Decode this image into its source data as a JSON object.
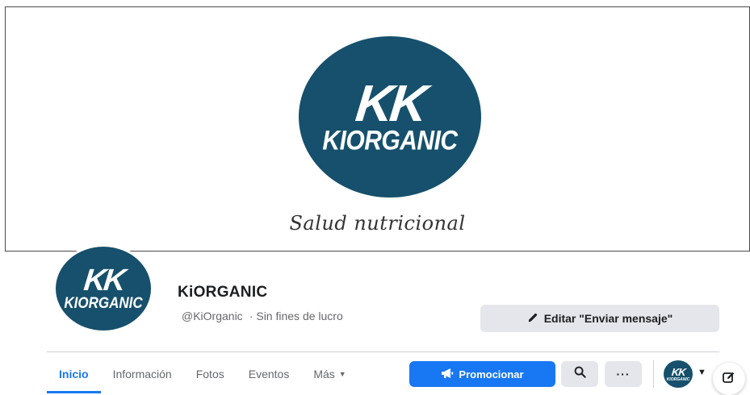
{
  "cover": {
    "logo_mark": "KK",
    "logo_word": "KIORGANIC",
    "tagline": "Salud nutricional"
  },
  "profile": {
    "avatar_mark": "KK",
    "avatar_word": "KIORGANIC",
    "name": "KiORGANIC",
    "handle": "@KiOrganic",
    "separator": "·",
    "category": "Sin fines de lucro"
  },
  "actions": {
    "edit_label": "Editar \"Enviar mensaje\"",
    "promote_label": "Promocionar",
    "more_label": "···"
  },
  "tabs": [
    {
      "label": "Inicio"
    },
    {
      "label": "Información"
    },
    {
      "label": "Fotos"
    },
    {
      "label": "Eventos"
    },
    {
      "label": "Más"
    }
  ],
  "mini_avatar": {
    "mark": "KK",
    "word": "KIORGANIC"
  },
  "colors": {
    "brand": "#16506c",
    "accent": "#1877f2",
    "button_gray": "#e4e6eb"
  },
  "icons": [
    "pencil-icon",
    "megaphone-icon",
    "search-icon",
    "caret-down-icon",
    "compose-icon"
  ]
}
